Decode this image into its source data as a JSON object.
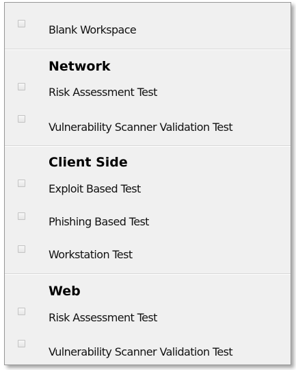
{
  "menu": {
    "items": [
      {
        "label": "Blank Workspace",
        "checked": false
      },
      {
        "heading": "Network"
      },
      {
        "label": "Risk Assessment Test",
        "checked": false
      },
      {
        "label": "Vulnerability Scanner Validation Test",
        "checked": false
      },
      {
        "heading": "Client Side"
      },
      {
        "label": "Exploit Based Test",
        "checked": false
      },
      {
        "label": "Phishing Based Test",
        "checked": false
      },
      {
        "label": "Workstation Test",
        "checked": false
      },
      {
        "heading": "Web"
      },
      {
        "label": "Risk Assessment Test",
        "checked": false
      },
      {
        "label": "Vulnerability Scanner Validation Test",
        "checked": false
      }
    ]
  },
  "icons": {
    "checkbox": "checkbox-icon"
  }
}
